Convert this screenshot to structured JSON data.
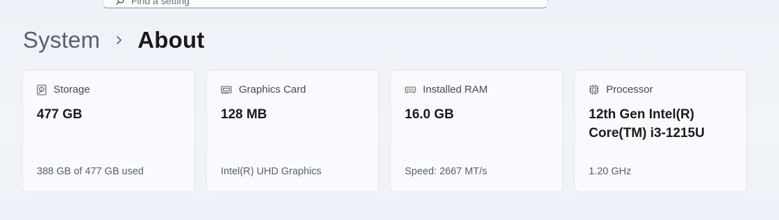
{
  "search": {
    "placeholder": "Find a setting",
    "icon": "search-icon"
  },
  "breadcrumb": {
    "parent": "System",
    "separator_icon": "chevron-right-icon",
    "current": "About"
  },
  "cards": [
    {
      "icon": "storage-icon",
      "label": "Storage",
      "value": "477 GB",
      "detail": "388 GB of 477 GB used"
    },
    {
      "icon": "graphics-card-icon",
      "label": "Graphics Card",
      "value": "128 MB",
      "detail": "Intel(R) UHD Graphics"
    },
    {
      "icon": "ram-icon",
      "label": "Installed RAM",
      "value": "16.0 GB",
      "detail": "Speed: 2667 MT/s"
    },
    {
      "icon": "processor-icon",
      "label": "Processor",
      "value": "12th Gen Intel(R) Core(TM) i3-1215U",
      "detail": "1.20 GHz"
    }
  ]
}
